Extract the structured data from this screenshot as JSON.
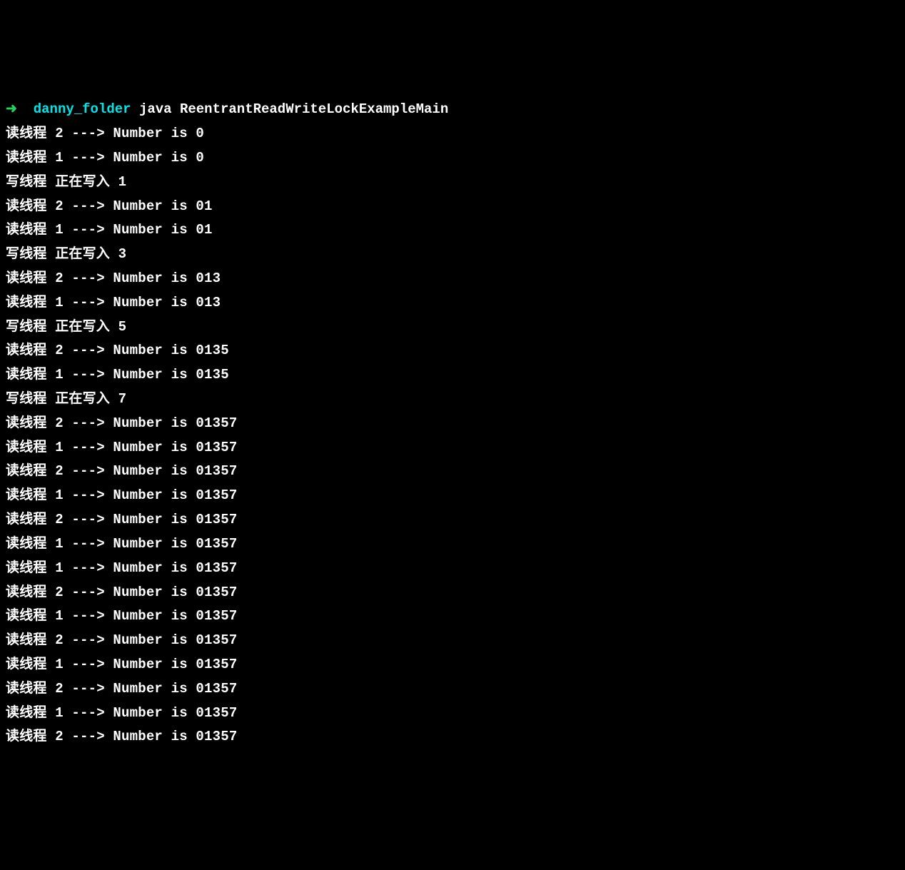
{
  "prompt": {
    "arrow": "➜",
    "folder": "danny_folder",
    "command": "java ReentrantReadWriteLockExampleMain"
  },
  "output": {
    "lines": [
      "读线程 2 ---> Number is 0",
      "读线程 1 ---> Number is 0",
      "写线程 正在写入 1",
      "读线程 2 ---> Number is 01",
      "读线程 1 ---> Number is 01",
      "写线程 正在写入 3",
      "读线程 2 ---> Number is 013",
      "读线程 1 ---> Number is 013",
      "写线程 正在写入 5",
      "读线程 2 ---> Number is 0135",
      "读线程 1 ---> Number is 0135",
      "写线程 正在写入 7",
      "读线程 2 ---> Number is 01357",
      "读线程 1 ---> Number is 01357",
      "读线程 2 ---> Number is 01357",
      "读线程 1 ---> Number is 01357",
      "读线程 2 ---> Number is 01357",
      "读线程 1 ---> Number is 01357",
      "读线程 1 ---> Number is 01357",
      "读线程 2 ---> Number is 01357",
      "读线程 1 ---> Number is 01357",
      "读线程 2 ---> Number is 01357",
      "读线程 1 ---> Number is 01357",
      "读线程 2 ---> Number is 01357",
      "读线程 1 ---> Number is 01357",
      "读线程 2 ---> Number is 01357"
    ]
  }
}
